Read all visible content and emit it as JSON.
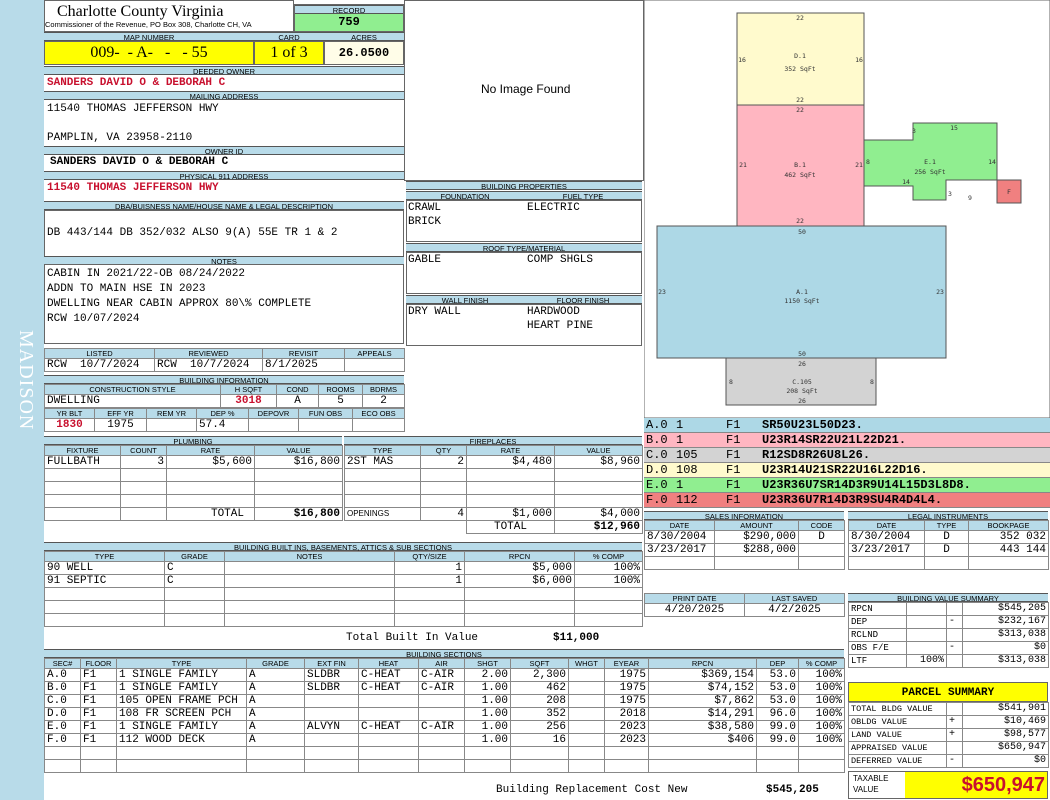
{
  "side_label": "MADISON",
  "county": {
    "name": "Charlotte County Virginia",
    "address": "Commissioner of the Revenue, PO Box 308, Charlotte CH, VA"
  },
  "record": {
    "label": "RECORD",
    "value": "759"
  },
  "map": {
    "label": "MAP NUMBER",
    "value": "009-  - A-   -   - 55"
  },
  "card": {
    "label": "CARD",
    "value": "1 of 3"
  },
  "acres": {
    "label": "ACRES",
    "value": "26.0500"
  },
  "deeded_owner": {
    "label": "DEEDED OWNER",
    "value": "SANDERS DAVID O & DEBORAH C"
  },
  "mailing": {
    "label": "MAILING ADDRESS",
    "line1": "11540 THOMAS JEFFERSON HWY",
    "line2": "PAMPLIN, VA 23958-2110"
  },
  "owner_id": {
    "label": "OWNER ID",
    "value": "SANDERS DAVID O & DEBORAH C"
  },
  "physical": {
    "label": "PHYSICAL 911 ADDRESS",
    "value": "11540 THOMAS JEFFERSON HWY"
  },
  "dba": {
    "label": "DBA/BUISNESS NAME/HOUSE NAME & LEGAL DESCRIPTION",
    "value": "DB 443/144 DB 352/032 ALSO 9(A) 55E TR 1 & 2"
  },
  "notes": {
    "label": "NOTES",
    "lines": [
      "CABIN IN 2021/22-OB 08/24/2022",
      "ADDN TO MAIN HSE IN 2023",
      "DWELLING NEAR CABIN APPROX 80\\% COMPLETE",
      "RCW 10/07/2024"
    ]
  },
  "image": {
    "text": "No Image Found"
  },
  "review": {
    "listed_label": "LISTED",
    "reviewed_label": "REVIEWED",
    "revisit_label": "REVISIT",
    "appeals_label": "APPEALS",
    "listed": "RCW  10/7/2024",
    "reviewed": "RCW  10/7/2024",
    "revisit": "8/1/2025",
    "appeals": ""
  },
  "building_info": {
    "label": "BUILDING INFORMATION",
    "cs_label": "CONSTRUCTION STYLE",
    "hsqft_label": "H SQFT",
    "cond_label": "COND",
    "rooms_label": "ROOMS",
    "bdrms_label": "BDRMS",
    "style": "DWELLING",
    "hsqft": "3018",
    "cond": "A",
    "rooms": "5",
    "bdrms": "2",
    "yrblt_label": "YR BLT",
    "effyr_label": "EFF YR",
    "remyr_label": "REM YR",
    "dep_label": "DEP %",
    "depovr_label": "DEPOVR",
    "funobs_label": "FUN OBS",
    "ecoobs_label": "ECO OBS",
    "yrblt": "1830",
    "effyr": "1975",
    "remyr": "",
    "dep": "57.4",
    "depovr": "",
    "funobs": "",
    "ecoobs": ""
  },
  "props": {
    "label": "BUILDING PROPERTIES",
    "foundation_label": "FOUNDATION",
    "fuel_label": "FUEL TYPE",
    "foundation1": "CRAWL",
    "foundation2": "BRICK",
    "fuel": "ELECTRIC",
    "roof_label": "ROOF TYPE/MATERIAL",
    "roof_type": "GABLE",
    "roof_mat": "COMP SHGLS",
    "wall_label": "WALL FINISH",
    "floor_label": "FLOOR FINISH",
    "wall": "DRY WALL",
    "floor1": "HARDWOOD",
    "floor2": "HEART PINE"
  },
  "plumbing": {
    "label": "PLUMBING",
    "headers": [
      "FIXTURE",
      "COUNT",
      "RATE",
      "VALUE"
    ],
    "rows": [
      [
        "FULLBATH",
        "3",
        "$5,600",
        "$16,800"
      ]
    ],
    "total_label": "TOTAL",
    "total": "$16,800"
  },
  "fireplaces": {
    "label": "FIREPLACES",
    "headers": [
      "TYPE",
      "QTY",
      "RATE",
      "VALUE"
    ],
    "rows": [
      [
        "2ST MAS",
        "2",
        "$4,480",
        "$8,960"
      ]
    ],
    "openings_label": "OPENINGS",
    "openings": [
      "4",
      "$1,000",
      "$4,000"
    ],
    "total_label": "TOTAL",
    "total": "$12,960"
  },
  "builtins": {
    "label": "BUILDING BUILT INS, BASEMENTS, ATTICS & SUB SECTIONS",
    "headers": [
      "TYPE",
      "GRADE",
      "NOTES",
      "QTY/SIZE",
      "RPCN",
      "% COMP"
    ],
    "rows": [
      [
        "90 WELL",
        "C",
        "",
        "1",
        "$5,000",
        "100%"
      ],
      [
        "91 SEPTIC",
        "C",
        "",
        "1",
        "$6,000",
        "100%"
      ]
    ],
    "total_label": "Total Built In Value",
    "total": "$11,000"
  },
  "sections": {
    "label": "BUILDING SECTIONS",
    "headers": [
      "SEC#",
      "FLOOR",
      "TYPE",
      "GRADE",
      "EXT FIN",
      "HEAT",
      "AIR",
      "SHGT",
      "SQFT",
      "WHGT",
      "EYEAR",
      "RPCN",
      "DEP",
      "% COMP"
    ],
    "rows": [
      [
        "A.0",
        "F1",
        "1 SINGLE FAMILY",
        "A",
        "SLDBR",
        "C-HEAT",
        "C-AIR",
        "2.00",
        "2,300",
        "",
        "1975",
        "$369,154",
        "53.0",
        "100%"
      ],
      [
        "B.0",
        "F1",
        "1 SINGLE FAMILY",
        "A",
        "SLDBR",
        "C-HEAT",
        "C-AIR",
        "1.00",
        "462",
        "",
        "1975",
        "$74,152",
        "53.0",
        "100%"
      ],
      [
        "C.0",
        "F1",
        "105 OPEN FRAME PCH",
        "A",
        "",
        "",
        "",
        "1.00",
        "208",
        "",
        "1975",
        "$7,862",
        "53.0",
        "100%"
      ],
      [
        "D.0",
        "F1",
        "108 FR SCREEN PCH",
        "A",
        "",
        "",
        "",
        "1.00",
        "352",
        "",
        "2018",
        "$14,291",
        "96.0",
        "100%"
      ],
      [
        "E.0",
        "F1",
        "1 SINGLE FAMILY",
        "A",
        "ALVYN",
        "C-HEAT",
        "C-AIR",
        "1.00",
        "256",
        "",
        "2023",
        "$38,580",
        "99.0",
        "100%"
      ],
      [
        "F.0",
        "F1",
        "112 WOOD DECK",
        "A",
        "",
        "",
        "",
        "1.00",
        "16",
        "",
        "2023",
        "$406",
        "99.0",
        "100%"
      ]
    ],
    "total_label": "Building Replacement Cost New",
    "total": "$545,205"
  },
  "sketch": {
    "areas": [
      {
        "id": "D.1",
        "sqft": "352 SqFt",
        "dims": [
          "22",
          "16",
          "16",
          "22"
        ]
      },
      {
        "id": "B.1",
        "sqft": "462 SqFt",
        "dims": [
          "22",
          "21",
          "21",
          "22"
        ]
      },
      {
        "id": "E.1",
        "sqft": "256 SqFt",
        "dims": [
          "15",
          "3",
          "8",
          "14",
          "14",
          "3",
          "9"
        ]
      },
      {
        "id": "A.1",
        "sqft": "1150 SqFt",
        "dims": [
          "50",
          "23",
          "23",
          "50"
        ]
      },
      {
        "id": "C.105",
        "sqft": "208 SqFt",
        "dims": [
          "26",
          "8",
          "8",
          "26"
        ]
      },
      {
        "id": "F",
        "sqft": "",
        "dims": []
      }
    ]
  },
  "legend": [
    {
      "sec": "A.0",
      "n": "1",
      "floor": "F1",
      "code": "SR50U23L50D23.",
      "color": "#add8e6"
    },
    {
      "sec": "B.0",
      "n": "1",
      "floor": "F1",
      "code": "U23R14SR22U21L22D21.",
      "color": "#ffb6c1"
    },
    {
      "sec": "C.0",
      "n": "105",
      "floor": "F1",
      "code": "R12SD8R26U8L26.",
      "color": "#d3d3d3"
    },
    {
      "sec": "D.0",
      "n": "108",
      "floor": "F1",
      "code": "U23R14U21SR22U16L22D16.",
      "color": "#fffacd"
    },
    {
      "sec": "E.0",
      "n": "1",
      "floor": "F1",
      "code": "U23R36U7SR14D3R9U14L15D3L8D8.",
      "color": "#90ee90"
    },
    {
      "sec": "F.0",
      "n": "112",
      "floor": "F1",
      "code": "U23R36U7R14D3R9SU4R4D4L4.",
      "color": "#f08080"
    }
  ],
  "sales": {
    "label": "SALES INFORMATION",
    "headers": [
      "DATE",
      "AMOUNT",
      "CODE"
    ],
    "rows": [
      [
        "8/30/2004",
        "$290,000",
        "D"
      ],
      [
        "3/23/2017",
        "$288,000",
        ""
      ]
    ]
  },
  "legal": {
    "label": "LEGAL INSTRUMENTS",
    "headers": [
      "DATE",
      "TYPE",
      "BOOKPAGE"
    ],
    "rows": [
      [
        "8/30/2004",
        "D",
        "352 032"
      ],
      [
        "3/23/2017",
        "D",
        "443 144"
      ]
    ]
  },
  "dates": {
    "print_label": "PRINT DATE",
    "saved_label": "LAST SAVED",
    "print": "4/20/2025",
    "saved": "4/2/2025"
  },
  "bvs": {
    "label": "BUILDING VALUE SUMMARY",
    "rows": [
      [
        "RPCN",
        "",
        "",
        "$545,205"
      ],
      [
        "DEP",
        "",
        "-",
        "$232,167"
      ],
      [
        "RCLND",
        "",
        "",
        "$313,038"
      ],
      [
        "OBS F/E",
        "",
        "-",
        "$0"
      ],
      [
        "LTF",
        "100%",
        "",
        "$313,038"
      ]
    ]
  },
  "parcel": {
    "label": "PARCEL SUMMARY",
    "rows": [
      [
        "TOTAL BLDG VALUE",
        "",
        "$541,901"
      ],
      [
        "OBLDG VALUE",
        "+",
        "$10,469"
      ],
      [
        "LAND VALUE",
        "+",
        "$98,577"
      ],
      [
        "APPRAISED VALUE",
        "",
        "$650,947"
      ],
      [
        "DEFERRED VALUE",
        "-",
        "$0"
      ]
    ],
    "taxable_label": "TAXABLE VALUE",
    "taxable": "$650,947"
  }
}
